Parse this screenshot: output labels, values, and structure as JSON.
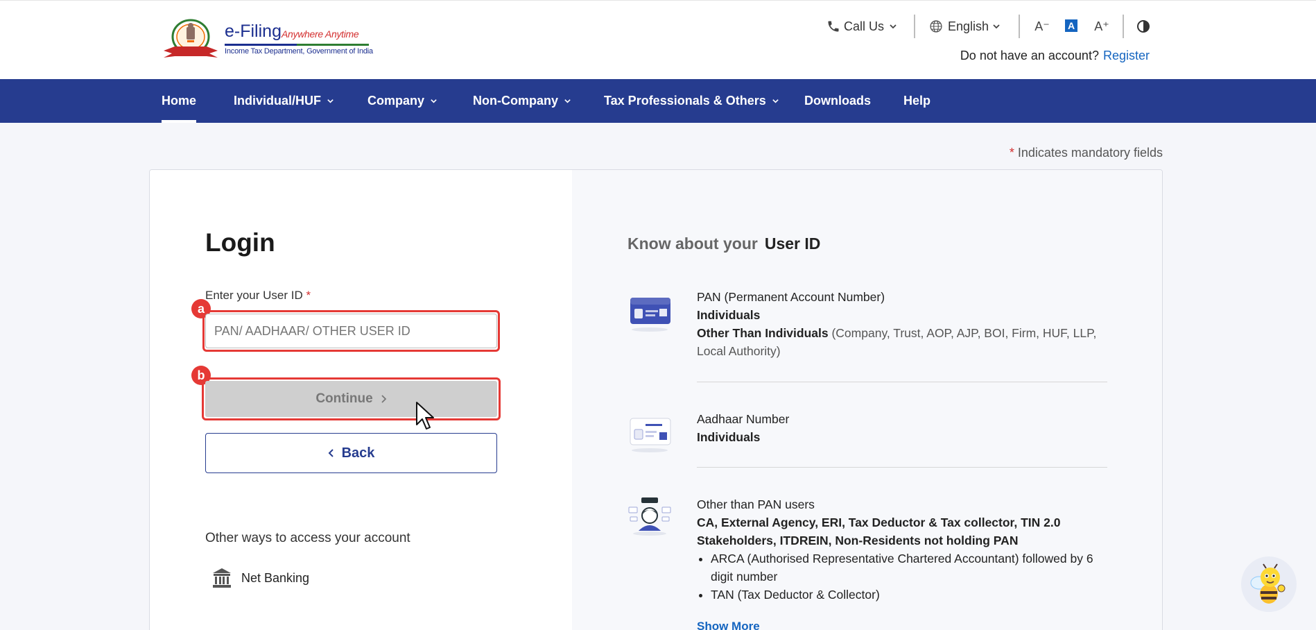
{
  "header": {
    "logo_title": "e-Filing",
    "logo_tagline": "Anywhere Anytime",
    "logo_subtitle": "Income Tax Department, Government of India",
    "call_us": "Call Us",
    "language": "English",
    "font_decrease": "A⁻",
    "font_default": "A",
    "font_increase": "A⁺",
    "no_account_text": "Do not have an account?",
    "register_link": "Register"
  },
  "nav": {
    "items": [
      {
        "label": "Home",
        "has_dropdown": false,
        "active": true
      },
      {
        "label": "Individual/HUF",
        "has_dropdown": true
      },
      {
        "label": "Company",
        "has_dropdown": true
      },
      {
        "label": "Non-Company",
        "has_dropdown": true
      },
      {
        "label": "Tax Professionals & Others",
        "has_dropdown": true
      },
      {
        "label": "Downloads",
        "has_dropdown": false
      },
      {
        "label": "Help",
        "has_dropdown": false
      }
    ]
  },
  "mandatory_note": {
    "star": "*",
    "text": "Indicates mandatory fields"
  },
  "login": {
    "title": "Login",
    "user_id_label": "Enter your User ID",
    "required_star": "*",
    "user_id_placeholder": "PAN/ AADHAAR/ OTHER USER ID",
    "user_id_value": "",
    "continue_label": "Continue",
    "back_label": "Back",
    "other_ways_heading": "Other ways to access your account",
    "net_banking_label": "Net Banking"
  },
  "annotations": {
    "badge_a": "a",
    "badge_b": "b"
  },
  "know": {
    "title_prefix": "Know about your",
    "title_strong": "User ID",
    "pan": {
      "line1": "PAN (Permanent Account Number)",
      "line2": "Individuals",
      "line3_bold": "Other Than Individuals",
      "line3_muted": " (Company, Trust, AOP, AJP, BOI, Firm, HUF, LLP, Local Authority)"
    },
    "aadhaar": {
      "line1": "Aadhaar Number",
      "line2": "Individuals"
    },
    "other": {
      "line1": "Other than PAN users",
      "line2": "CA, External Agency, ERI, Tax Deductor & Tax collector, TIN 2.0 Stakeholders, ITDREIN, Non-Residents not holding PAN",
      "bullets": [
        "ARCA (Authorised Representative Chartered Accountant) followed by 6 digit number",
        "TAN (Tax Deductor & Collector)"
      ]
    },
    "show_more": "Show More"
  },
  "colors": {
    "nav_bg": "#263c8f",
    "link": "#1565c0",
    "required": "#d32f2f",
    "highlight": "#e53935",
    "continue_disabled": "#cfcfcf"
  }
}
